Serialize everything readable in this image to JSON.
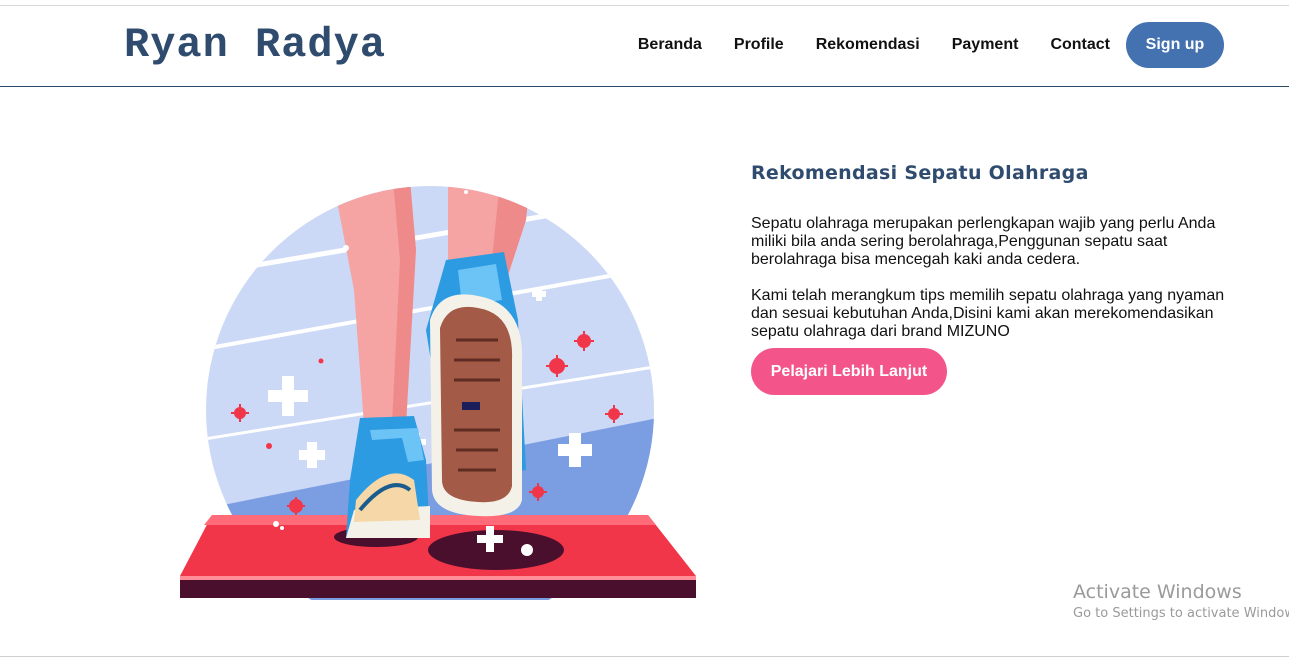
{
  "brand": {
    "logo_text": "Ryan Radya"
  },
  "nav": {
    "items": [
      {
        "label": "Beranda"
      },
      {
        "label": "Profile"
      },
      {
        "label": "Rekomendasi"
      },
      {
        "label": "Payment"
      },
      {
        "label": "Contact"
      }
    ],
    "signup_label": "Sign up"
  },
  "hero": {
    "heading": "Rekomendasi Sepatu Olahraga",
    "paragraph_1": "Sepatu olahraga merupakan perlengkapan wajib yang perlu Anda miliki bila anda sering berolahraga,Penggunan sepatu saat berolahraga bisa mencegah kaki anda cedera.",
    "paragraph_2": "Kami telah merangkum tips memilih sepatu olahraga yang nyaman dan sesuai kebutuhan Anda,Disini kami akan merekomendasikan sepatu olahraga dari brand MIZUNO",
    "cta_label": "Pelajari Lebih Lanjut",
    "illustration_icon": "running-shoes-illustration"
  },
  "os_overlay": {
    "title": "Activate Windows",
    "subtitle": "Go to Settings to activate Windows."
  },
  "colors": {
    "primary": "#2f4b6e",
    "signup": "#4472b0",
    "cta": "#f3558a",
    "accent_red": "#f2364a"
  }
}
